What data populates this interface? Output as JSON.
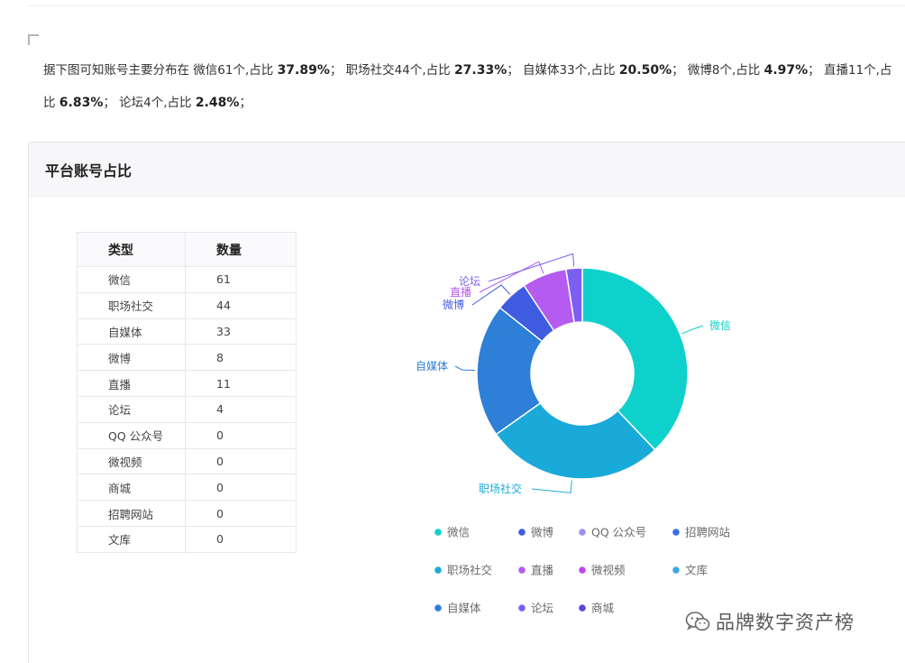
{
  "summary": {
    "intro": "据下图可知账号主要分布在 ",
    "items": [
      {
        "name": "微信",
        "count": "61个,占比 ",
        "pct": "37.89%",
        "sep": "； "
      },
      {
        "name": "职场社交",
        "count": "44个,占比 ",
        "pct": "27.33%",
        "sep": "； "
      },
      {
        "name": "自媒体",
        "count": "33个,占比 ",
        "pct": "20.50%",
        "sep": "； "
      },
      {
        "name": "微博",
        "count": "8个,占比 ",
        "pct": "4.97%",
        "sep": "； "
      },
      {
        "name": "直播",
        "count": "11个,占比 ",
        "pct": "6.83%",
        "sep": "； "
      },
      {
        "name": "论坛",
        "count": "4个,占比 ",
        "pct": "2.48%",
        "sep": "；"
      }
    ]
  },
  "panel": {
    "title": "平台账号占比"
  },
  "table": {
    "headers": [
      "类型",
      "数量"
    ],
    "rows": [
      [
        "微信",
        "61"
      ],
      [
        "职场社交",
        "44"
      ],
      [
        "自媒体",
        "33"
      ],
      [
        "微博",
        "8"
      ],
      [
        "直播",
        "11"
      ],
      [
        "论坛",
        "4"
      ],
      [
        "QQ 公众号",
        "0"
      ],
      [
        "微视频",
        "0"
      ],
      [
        "商城",
        "0"
      ],
      [
        "招聘网站",
        "0"
      ],
      [
        "文库",
        "0"
      ]
    ]
  },
  "chart_data": {
    "type": "pie",
    "variant": "donut",
    "title": "",
    "series": [
      {
        "name": "微信",
        "value": 61,
        "color": "#0fd1cb"
      },
      {
        "name": "职场社交",
        "value": 44,
        "color": "#1aaad9"
      },
      {
        "name": "自媒体",
        "value": 33,
        "color": "#2d7fd8"
      },
      {
        "name": "微博",
        "value": 8,
        "color": "#3f5be0"
      },
      {
        "name": "直播",
        "value": 11,
        "color": "#b55bf0"
      },
      {
        "name": "论坛",
        "value": 4,
        "color": "#7a5ff0"
      },
      {
        "name": "QQ 公众号",
        "value": 0,
        "color": "#a08ef0"
      },
      {
        "name": "微视频",
        "value": 0,
        "color": "#c045e8"
      },
      {
        "name": "商城",
        "value": 0,
        "color": "#5a45d8"
      },
      {
        "name": "招聘网站",
        "value": 0,
        "color": "#3a6fe0"
      },
      {
        "name": "文库",
        "value": 0,
        "color": "#3fa9e6"
      }
    ],
    "legend_order": [
      "微信",
      "微博",
      "QQ 公众号",
      "招聘网站",
      "职场社交",
      "直播",
      "微视频",
      "文库",
      "自媒体",
      "论坛",
      "商城"
    ],
    "legend_position": "bottom"
  },
  "watermark": {
    "text": "品牌数字资产榜",
    "icon": "wechat-icon"
  }
}
